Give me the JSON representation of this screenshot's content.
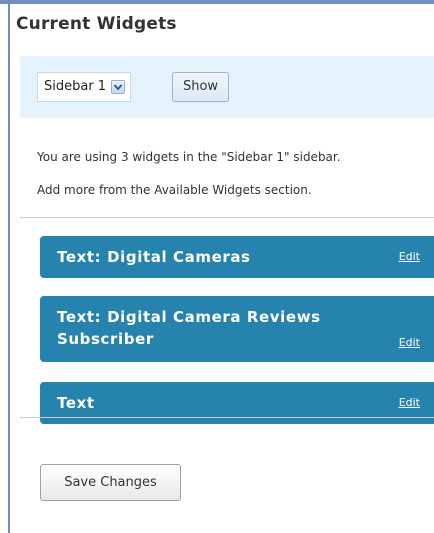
{
  "panel": {
    "title": "Current Widgets"
  },
  "toolbar": {
    "sidebar_select": {
      "selected": "Sidebar 1",
      "arrow_icon": "chevron-down-icon"
    },
    "show_label": "Show"
  },
  "info": {
    "line1": "You are using 3 widgets in the \"Sidebar 1\" sidebar.",
    "line2": "Add more from the Available Widgets section."
  },
  "widgets": [
    {
      "title": "Text: Digital Cameras",
      "edit_label": "Edit"
    },
    {
      "title_line1": "Text: Digital Camera Reviews",
      "title_line2": "Subscriber",
      "edit_label": "Edit"
    },
    {
      "title": "Text",
      "edit_label": "Edit"
    }
  ],
  "actions": {
    "save_label": "Save Changes"
  },
  "colors": {
    "widget_bar": "#2683ae",
    "toolbar_bg": "#e4f2fd",
    "frame_accent": "#6f8fbd"
  }
}
